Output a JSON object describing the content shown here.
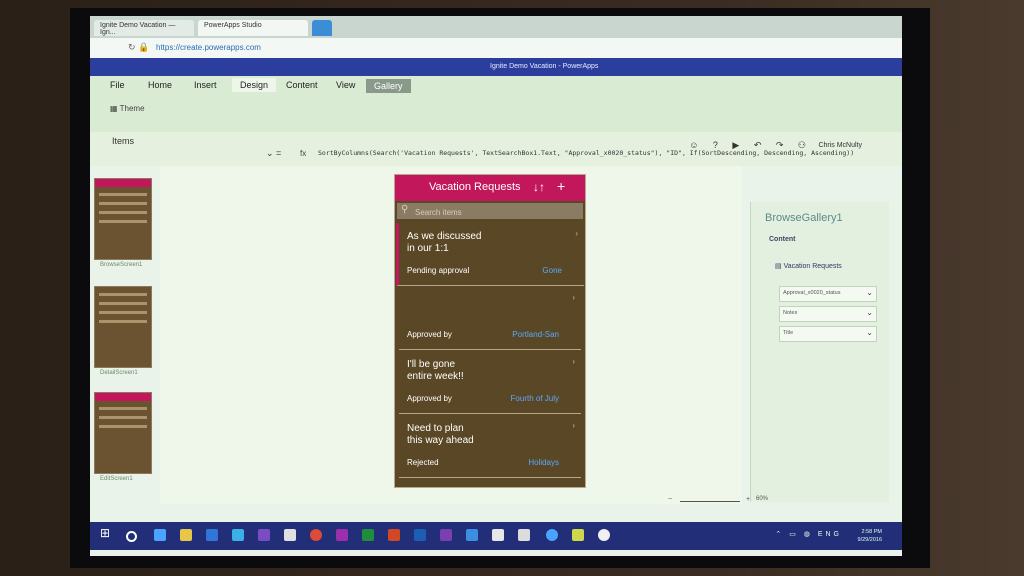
{
  "browser": {
    "tabs": [
      "Ignite Demo Vacation — Ign...",
      "PowerApps Studio"
    ],
    "url": "https://create.powerapps.com"
  },
  "app": {
    "window_title": "Ignite Demo Vacation - PowerApps",
    "user": "Chris McNulty"
  },
  "ribbon": {
    "tabs": [
      "File",
      "Home",
      "Insert",
      "Design",
      "Content",
      "View",
      "Gallery"
    ],
    "active_tab": "Design",
    "theme_label": "Theme"
  },
  "formula_bar": {
    "property": "Items",
    "fx": "fx",
    "formula": "SortByColumns(Search('Vacation Requests', TextSearchBox1.Text, \"Approval_x0020_status\"), \"ID\", If(SortDescending, Descending, Ascending))"
  },
  "screens": [
    {
      "label": "BrowseScreen1"
    },
    {
      "label": "DetailScreen1"
    },
    {
      "label": "EditScreen1"
    }
  ],
  "gallery_app": {
    "title": "Vacation Requests",
    "sort_icon": "↓↑",
    "add_icon": "+",
    "search_placeholder": "Search items",
    "items": [
      {
        "notes": "As we discussed\nin our 1:1",
        "status": "Pending approval",
        "title": "Gone"
      },
      {
        "notes": "",
        "status": "Approved by",
        "title": "Portland-San"
      },
      {
        "notes": "I'll be gone\nentire week!!",
        "status": "Approved by",
        "title": "Fourth of July"
      },
      {
        "notes": "Need to plan\nthis way ahead",
        "status": "Rejected",
        "title": "Holidays"
      }
    ]
  },
  "properties_panel": {
    "name": "BrowseGallery1",
    "content_label": "Content",
    "data_source": "Vacation Requests",
    "fields": [
      "Approval_x0020_status",
      "Notes",
      "Title"
    ]
  },
  "zoom": {
    "percent": "60%"
  },
  "clock": {
    "time": "2:58 PM",
    "date": "9/29/2016"
  },
  "tray": {
    "lang": "ENG"
  },
  "colors": {
    "accent": "#c2185b",
    "gallery_bg": "#5a4725",
    "link": "#5aa8ff"
  }
}
